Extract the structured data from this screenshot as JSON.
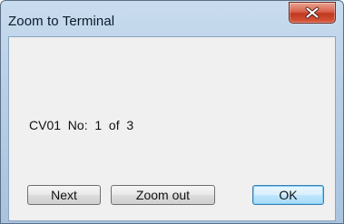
{
  "window": {
    "title": "Zoom to Terminal"
  },
  "content": {
    "info_text": "CV01  No:  1  of  3"
  },
  "buttons": {
    "next": "Next",
    "zoom_out": "Zoom out",
    "ok": "OK"
  },
  "icons": {
    "close": "close-icon"
  },
  "colors": {
    "close_button": "#c9432a",
    "ok_border": "#3c7fb1"
  }
}
